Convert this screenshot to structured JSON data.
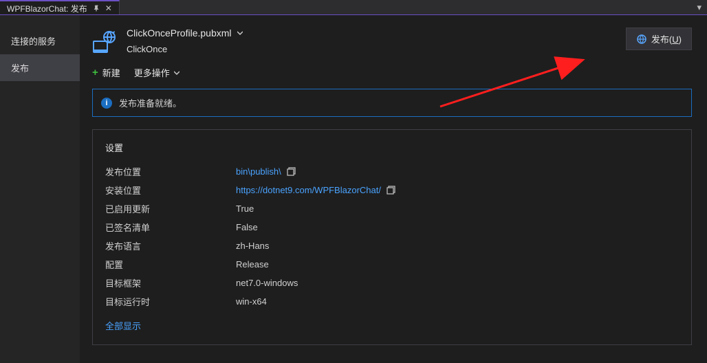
{
  "tab": {
    "title": "WPFBlazorChat: 发布"
  },
  "sidebar": {
    "items": [
      {
        "label": "连接的服务",
        "selected": false
      },
      {
        "label": "发布",
        "selected": true
      }
    ]
  },
  "profile": {
    "file": "ClickOnceProfile.pubxml",
    "method": "ClickOnce",
    "publish_button_prefix": "发布(",
    "publish_button_hotkey": "U",
    "publish_button_suffix": ")"
  },
  "toolbar": {
    "new_label": "新建",
    "more_label": "更多操作"
  },
  "status": {
    "text": "发布准备就绪。"
  },
  "settings": {
    "title": "设置",
    "rows": [
      {
        "key": "发布位置",
        "value": "bin\\publish\\",
        "link": true,
        "copyable": true
      },
      {
        "key": "安装位置",
        "value": "https://dotnet9.com/WPFBlazorChat/",
        "link": true,
        "copyable": true
      },
      {
        "key": "已启用更新",
        "value": "True",
        "link": false,
        "copyable": false
      },
      {
        "key": "已签名清单",
        "value": "False",
        "link": false,
        "copyable": false
      },
      {
        "key": "发布语言",
        "value": "zh-Hans",
        "link": false,
        "copyable": false
      },
      {
        "key": "配置",
        "value": "Release",
        "link": false,
        "copyable": false
      },
      {
        "key": "目标框架",
        "value": "net7.0-windows",
        "link": false,
        "copyable": false
      },
      {
        "key": "目标运行时",
        "value": "win-x64",
        "link": false,
        "copyable": false
      }
    ],
    "show_all_label": "全部显示"
  },
  "colors": {
    "accent_purple": "#6a50c4",
    "link_blue": "#4aa3ff",
    "info_blue": "#1b6ec2"
  }
}
